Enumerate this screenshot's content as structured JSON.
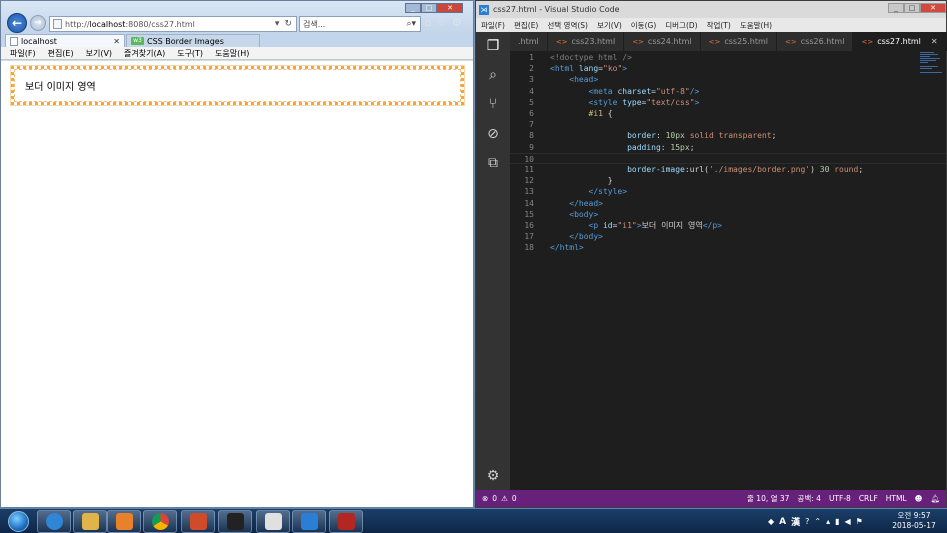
{
  "ie": {
    "url_prefix": "http://",
    "url_host": "localhost",
    "url_rest": ":8080/css27.html",
    "search_placeholder": "검색...",
    "tabs": [
      {
        "label": "localhost"
      },
      {
        "label": "CSS Border Images"
      }
    ],
    "w3_badge": "w3",
    "menu": [
      "파일(F)",
      "편집(E)",
      "보기(V)",
      "즐겨찾기(A)",
      "도구(T)",
      "도움말(H)"
    ],
    "demo_text": "보더 이미지 영역"
  },
  "vscode": {
    "title": "css27.html - Visual Studio Code",
    "menu": [
      "파일(F)",
      "편집(E)",
      "선택 영역(S)",
      "보기(V)",
      "이동(G)",
      "디버그(D)",
      "작업(T)",
      "도움말(H)"
    ],
    "tabs": [
      {
        "label": ".html"
      },
      {
        "label": "css23.html"
      },
      {
        "label": "css24.html"
      },
      {
        "label": "css25.html"
      },
      {
        "label": "css26.html"
      },
      {
        "label": "css27.html",
        "active": true
      }
    ],
    "tab_tag": "<>",
    "status": {
      "errors": "0",
      "warnings": "0",
      "position": "줄 10, 열 37",
      "spaces": "공백: 4",
      "encoding": "UTF-8",
      "eol": "CRLF",
      "language": "HTML"
    }
  },
  "code_lines": [
    [
      [
        "t-punc",
        "<!doctype html />"
      ]
    ],
    [
      [
        "t-tag",
        "<html "
      ],
      [
        "t-attr",
        "lang"
      ],
      [
        "t-txt",
        "="
      ],
      [
        "t-str",
        "\"ko\""
      ],
      [
        "t-tag",
        ">"
      ]
    ],
    [
      [
        "t-txt",
        "    "
      ],
      [
        "t-tag",
        "<head>"
      ]
    ],
    [
      [
        "t-txt",
        "        "
      ],
      [
        "t-tag",
        "<meta "
      ],
      [
        "t-attr",
        "charset"
      ],
      [
        "t-txt",
        "="
      ],
      [
        "t-str",
        "\"utf-8\""
      ],
      [
        "t-tag",
        "/>"
      ]
    ],
    [
      [
        "t-txt",
        "        "
      ],
      [
        "t-tag",
        "<style "
      ],
      [
        "t-attr",
        "type"
      ],
      [
        "t-txt",
        "="
      ],
      [
        "t-str",
        "\"text/css\""
      ],
      [
        "t-tag",
        ">"
      ]
    ],
    [
      [
        "t-txt",
        "        "
      ],
      [
        "t-sel",
        "#i1"
      ],
      [
        "t-txt",
        " {"
      ]
    ],
    [
      [
        "t-txt",
        ""
      ]
    ],
    [
      [
        "t-txt",
        "                "
      ],
      [
        "t-attr",
        "border"
      ],
      [
        "t-txt",
        ": "
      ],
      [
        "t-num",
        "10px"
      ],
      [
        "t-txt",
        " "
      ],
      [
        "t-str",
        "solid transparent"
      ],
      [
        "t-txt",
        ";"
      ]
    ],
    [
      [
        "t-txt",
        "                "
      ],
      [
        "t-attr",
        "padding"
      ],
      [
        "t-txt",
        ": "
      ],
      [
        "t-num",
        "15px"
      ],
      [
        "t-txt",
        ";"
      ]
    ],
    [
      [
        "t-txt",
        ""
      ]
    ],
    [
      [
        "t-txt",
        "                "
      ],
      [
        "t-attr",
        "border-image"
      ],
      [
        "t-txt",
        ":url("
      ],
      [
        "t-str",
        "'./images/border.png'"
      ],
      [
        "t-txt",
        ") "
      ],
      [
        "t-num",
        "30"
      ],
      [
        "t-txt",
        " "
      ],
      [
        "t-str",
        "round"
      ],
      [
        "t-txt",
        ";"
      ]
    ],
    [
      [
        "t-txt",
        "            }"
      ]
    ],
    [
      [
        "t-txt",
        "        "
      ],
      [
        "t-tag",
        "</style>"
      ]
    ],
    [
      [
        "t-txt",
        "    "
      ],
      [
        "t-tag",
        "</head>"
      ]
    ],
    [
      [
        "t-txt",
        "    "
      ],
      [
        "t-tag",
        "<body>"
      ]
    ],
    [
      [
        "t-txt",
        "        "
      ],
      [
        "t-tag",
        "<p "
      ],
      [
        "t-attr",
        "id"
      ],
      [
        "t-txt",
        "="
      ],
      [
        "t-str",
        "\"i1\""
      ],
      [
        "t-tag",
        ">"
      ],
      [
        "t-txt",
        "보더 이미지 영역"
      ],
      [
        "t-tag",
        "</p>"
      ]
    ],
    [
      [
        "t-txt",
        "    "
      ],
      [
        "t-tag",
        "</body>"
      ]
    ],
    [
      [
        "t-tag",
        "</html>"
      ]
    ]
  ],
  "taskbar": {
    "apps": [
      "ie-icon",
      "explorer-icon",
      "media-player-icon",
      "chrome-icon",
      "powerpoint-icon",
      "cmd-icon",
      "java-icon",
      "vscode-icon",
      "filezilla-icon"
    ],
    "ime_label": "A",
    "ime_hanja": "漢",
    "clock_time": "오전 9:57",
    "clock_date": "2018-05-17"
  }
}
